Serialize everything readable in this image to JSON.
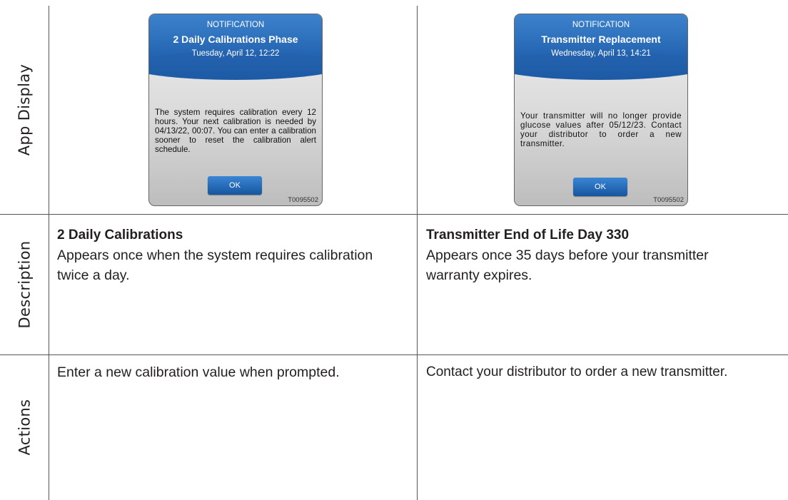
{
  "row_labels": {
    "app_display": "App Display",
    "description": "Description",
    "actions": "Actions"
  },
  "columns": [
    {
      "notification": {
        "label": "NOTIFICATION",
        "title": "2 Daily Calibrations Phase",
        "date": "Tuesday, April 12, 12:22",
        "message": "The system requires calibration every 12 hours. Your next calibration is needed by 04/13/22, 00:07. You can enter a calibration sooner to reset the calibration alert schedule.",
        "button": "OK",
        "code": "T0095502"
      },
      "description_title": "2 Daily Calibrations",
      "description_text": "Appears once when the system requires calibration twice a day.",
      "action_text": "Enter a new calibration value when prompted."
    },
    {
      "notification": {
        "label": "NOTIFICATION",
        "title": "Transmitter Replacement",
        "date": "Wednesday, April 13, 14:21",
        "message": "Your transmitter will no longer provide glucose values after 05/12/23. Contact your distributor to order a new transmitter.",
        "button": "OK",
        "code": "T0095502"
      },
      "description_title": "Transmitter End of Life Day 330",
      "description_text": "Appears once 35 days before your transmitter warranty expires.",
      "action_text": "Contact your distributor to order a new transmitter."
    }
  ]
}
